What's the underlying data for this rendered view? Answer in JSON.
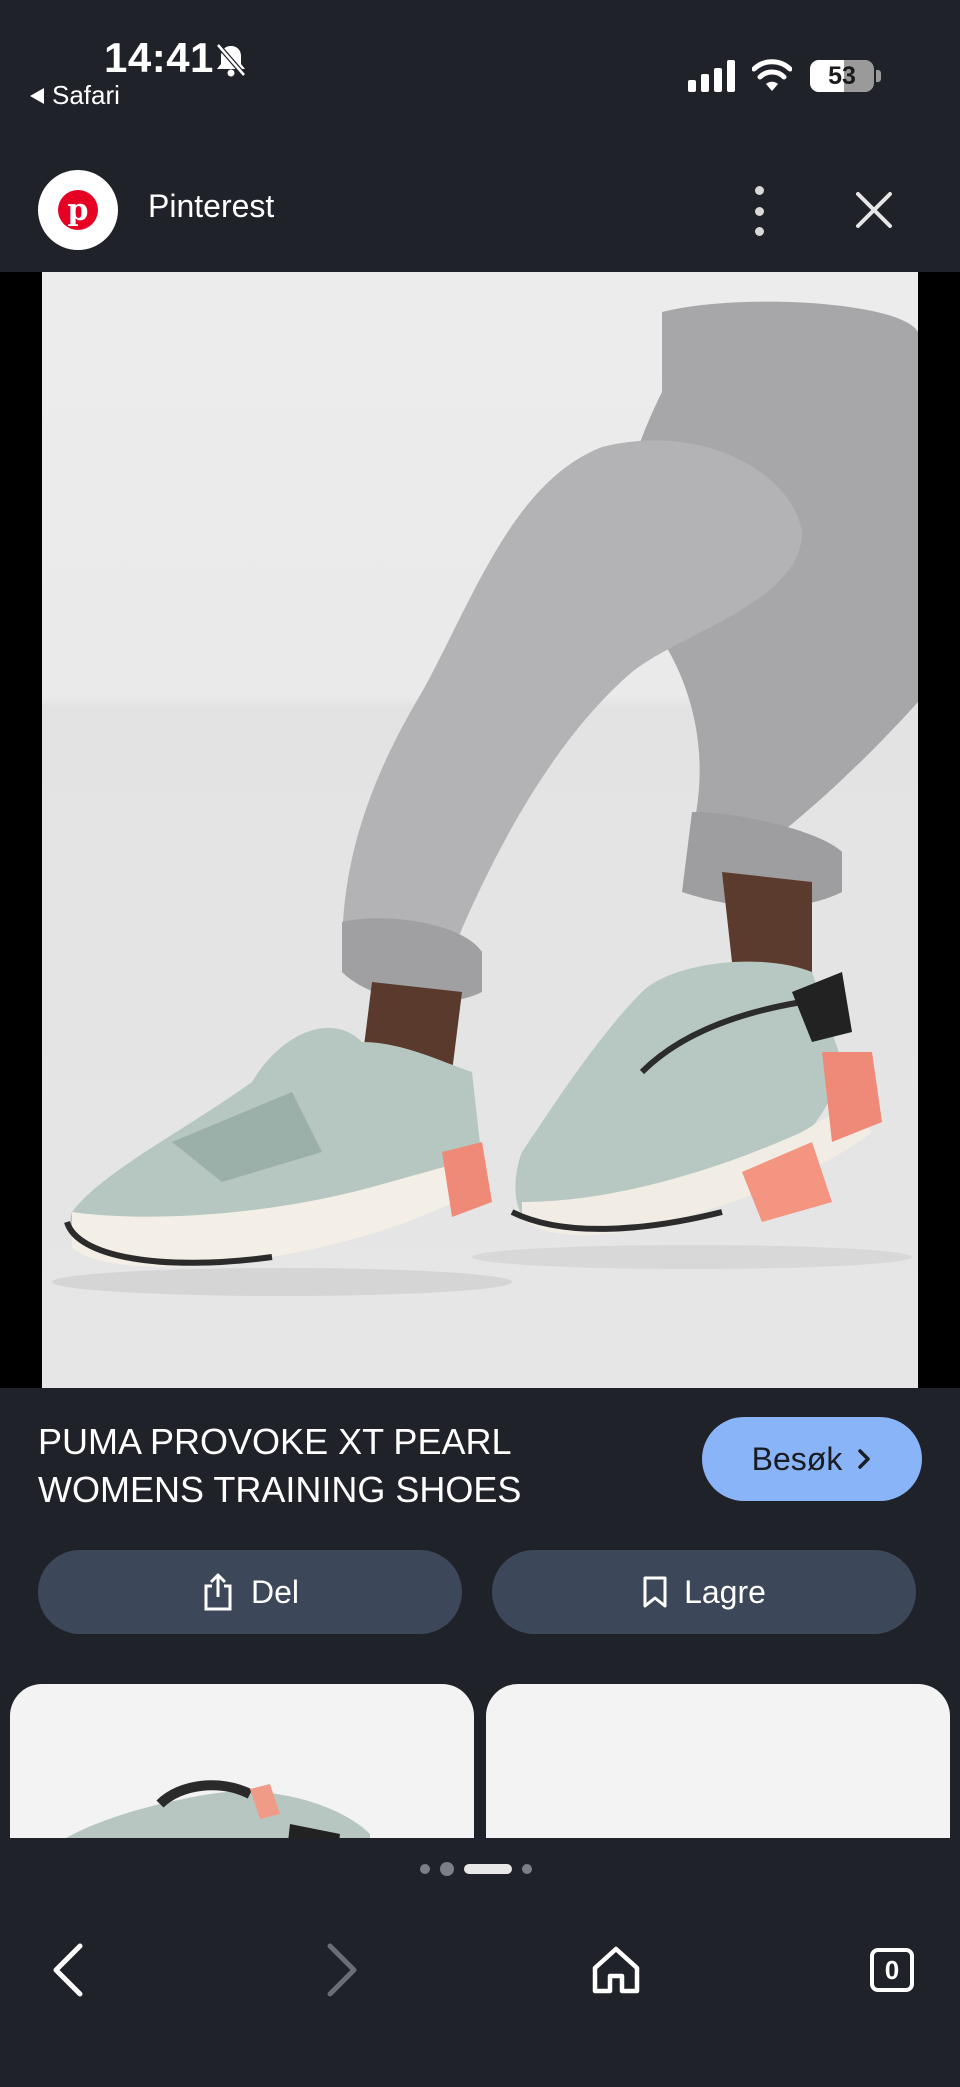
{
  "status_bar": {
    "time": "14:41",
    "back_app": "Safari",
    "battery": "53",
    "battery_level": 0.53,
    "icons": [
      "bell-slash-icon",
      "cellular-signal-icon",
      "wifi-icon",
      "battery-icon"
    ]
  },
  "header": {
    "logo_letter": "p",
    "site_name": "Pinterest",
    "icons": [
      "more-vertical-icon",
      "close-icon"
    ]
  },
  "pin": {
    "title": "PUMA PROVOKE XT PEARL WOMENS TRAINING SHOES",
    "visit_label": "Besøk",
    "share_label": "Del",
    "save_label": "Lagre"
  },
  "carousel": {
    "page_count": 4,
    "active_page": 3
  },
  "bottom_nav": {
    "tab_count": "0",
    "icons": [
      "back-arrow-icon",
      "forward-arrow-icon",
      "home-icon",
      "tabs-icon"
    ]
  },
  "colors": {
    "background": "#202229",
    "accent_button": "#8ab4f8",
    "secondary_button": "#3c475a",
    "pinterest_red": "#e60023"
  }
}
